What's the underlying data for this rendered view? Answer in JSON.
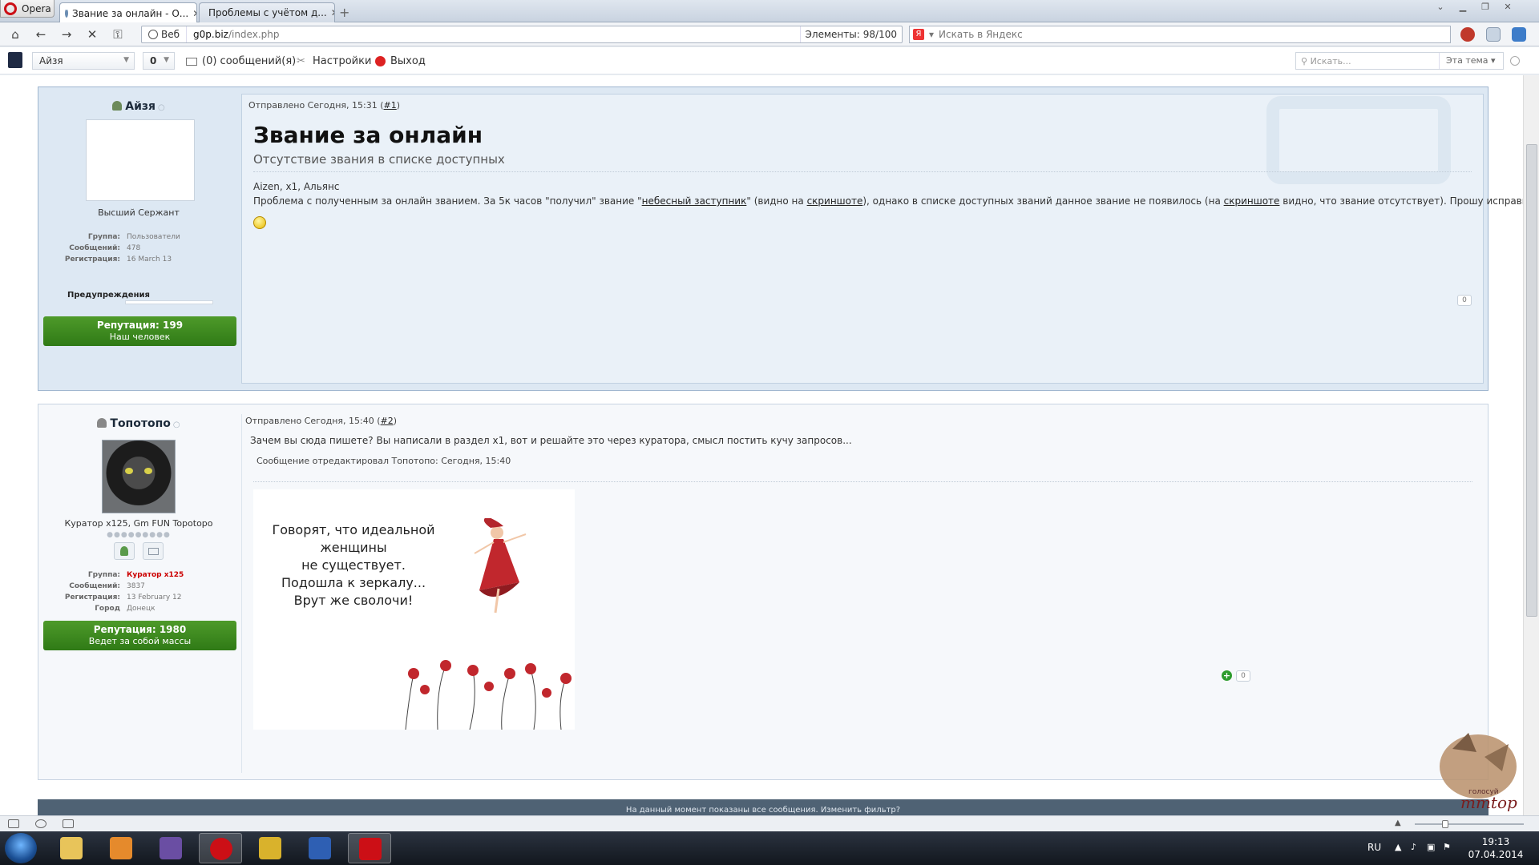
{
  "browser": {
    "menu_label": "Opera",
    "tabs": [
      {
        "title": "Звание за онлайн - О...",
        "active": true
      },
      {
        "title": "Проблемы с учётом д...",
        "active": false
      }
    ],
    "address": {
      "badge": "Веб",
      "host": "g0p.biz",
      "path": "/index.php",
      "elements_label": "Элементы:",
      "elements_value": "98/100"
    },
    "search_placeholder": "Искать в Яндекс"
  },
  "userbar": {
    "username": "Айзя",
    "counter": "0",
    "messages": "(0) сообщений(я)",
    "settings": "Настройки",
    "logout": "Выход",
    "search_placeholder": "Искать...",
    "search_scope": "Эта тема"
  },
  "posts": [
    {
      "author": "Айзя",
      "rank": "Высший Сержант",
      "info": [
        {
          "k": "Группа:",
          "v": "Пользователи"
        },
        {
          "k": "Сообщений:",
          "v": "478"
        },
        {
          "k": "Регистрация:",
          "v": "16 March 13"
        }
      ],
      "warnings_label": "Предупреждения",
      "reputation": "Репутация: 199",
      "reputation_title": "Наш человек",
      "posted_prefix": "Отправлено Сегодня, 15:31 (",
      "post_num": "#1",
      "posted_suffix": ")",
      "title": "Звание за онлайн",
      "subtitle": "Отсутствие звания в списке доступных",
      "line1": "Aizen, x1, Альянс",
      "line2_a": "Проблема с полученным за онлайн званием. За 5к часов \"получил\" звание \"",
      "line2_link1": "небесный заступник",
      "line2_b": "\" (видно на ",
      "line2_link2": "скриншоте",
      "line2_c": "), однако в списке доступных званий данное звание не появилось (на ",
      "line2_link3": "скриншоте",
      "line2_d": " видно, что звание отсутствует). Прошу исправить, спасибо",
      "count": "0"
    },
    {
      "author": "Топотопо",
      "rank": "Куратор x125, Gm FUN Topotopo",
      "info": [
        {
          "k": "Группа:",
          "v": "Куратор x125"
        },
        {
          "k": "Сообщений:",
          "v": "3837"
        },
        {
          "k": "Регистрация:",
          "v": "13 February 12"
        },
        {
          "k": "Город",
          "v": "Донецк"
        }
      ],
      "reputation": "Репутация: 1980",
      "reputation_title": "Ведет за собой массы",
      "posted_prefix": "Отправлено Сегодня, 15:40 (",
      "post_num": "#2",
      "posted_suffix": ")",
      "text": "Зачем вы сюда пишете? Вы написали в раздел x1, вот и решайте это через куратора, смысл постить кучу запросов...",
      "edited": "Сообщение отредактировал Топотопо: Сегодня, 15:40",
      "image_text": [
        "Говорят, что идеальной женщины",
        "не существует.",
        "Подошла к зеркалу...",
        "Врут же сволочи!"
      ],
      "count": "0"
    }
  ],
  "filter_notice": "На данный момент показаны все сообщения. Изменить фильтр?",
  "corner_logo_text": "mmtop",
  "corner_logo_sub": "голосуй",
  "taskbar": {
    "lang": "RU",
    "time": "19:13",
    "date": "07.04.2014"
  }
}
